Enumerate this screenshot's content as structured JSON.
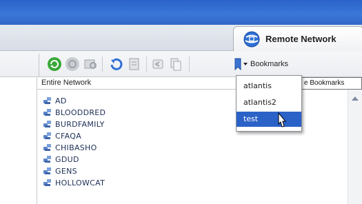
{
  "tab": {
    "title": "Remote Network",
    "icon": "network-globe-icon"
  },
  "toolbar": {
    "icons": [
      "refresh-icon",
      "stop-icon",
      "browse-icon",
      "connect-icon",
      "properties-icon",
      "back-icon",
      "copy-icon"
    ],
    "bookmarks_label": "Bookmarks",
    "bookmarks_icon": "bookmark-icon"
  },
  "list_header": {
    "label": "Entire Network",
    "right_label": "e Bookmarks"
  },
  "network_items": [
    {
      "label": "AD"
    },
    {
      "label": "BLOODDRED"
    },
    {
      "label": "BURDFAMILY"
    },
    {
      "label": "CFAQA"
    },
    {
      "label": "CHIBASHO"
    },
    {
      "label": "GDUD"
    },
    {
      "label": "GENS"
    },
    {
      "label": "HOLLOWCAT"
    }
  ],
  "bookmarks_menu": {
    "items": [
      "atlantis",
      "atlantis2",
      "test"
    ],
    "selected": "test"
  },
  "colors": {
    "title_blue": "#3268c8",
    "selection_blue": "#2b62c8",
    "list_text": "#1c2e55"
  }
}
